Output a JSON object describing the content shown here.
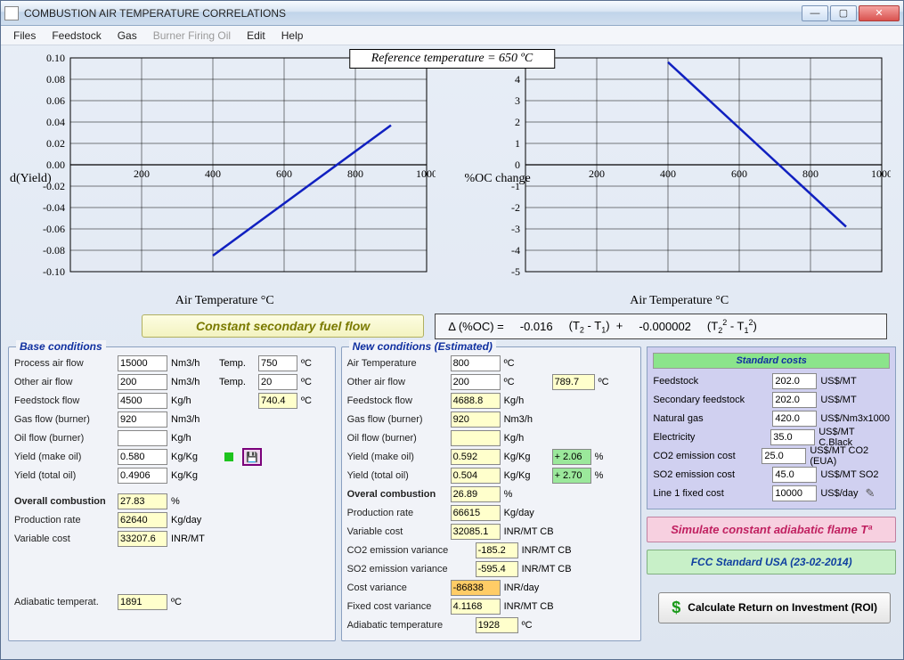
{
  "window": {
    "title": "COMBUSTION AIR TEMPERATURE CORRELATIONS"
  },
  "menu": {
    "items": [
      "Files",
      "Feedstock",
      "Gas",
      "Burner Firing Oil",
      "Edit",
      "Help"
    ],
    "disabled_index": 3
  },
  "ref_temp_label": "Reference temperature = 650 ºC",
  "chart1": {
    "ylabel": "d(Yield)",
    "xlabel": "Air Temperature °C"
  },
  "chart2": {
    "ylabel": "%OC change",
    "xlabel": "Air Temperature °C"
  },
  "constant_btn": "Constant secondary fuel flow",
  "formula": {
    "lhs": "Δ (%OC)  =",
    "a": "-0.016",
    "t1": "(T₂ - T₁)  +",
    "b": "-0.000002",
    "t2": "(T₂² - T₁²)"
  },
  "base": {
    "legend": "Base conditions",
    "rows": {
      "process_air": {
        "label": "Process air flow",
        "val": "15000",
        "unit": "Nm3/h",
        "l2": "Temp.",
        "v2": "750",
        "u2": "ºC"
      },
      "other_air": {
        "label": "Other air flow",
        "val": "200",
        "unit": "Nm3/h",
        "l2": "Temp.",
        "v2": "20",
        "u2": "ºC"
      },
      "feedstock": {
        "label": "Feedstock flow",
        "val": "4500",
        "unit": "Kg/h",
        "l2": "",
        "v2": "740.4",
        "u2": "ºC"
      },
      "gas_flow": {
        "label": "Gas flow (burner)",
        "val": "920",
        "unit": "Nm3/h"
      },
      "oil_flow": {
        "label": "Oil flow (burner)",
        "val": "",
        "unit": "Kg/h"
      },
      "yield_make": {
        "label": "Yield (make oil)",
        "val": "0.580",
        "unit": "Kg/Kg"
      },
      "yield_total": {
        "label": "Yield (total oil)",
        "val": "0.4906",
        "unit": "Kg/Kg"
      },
      "overall": {
        "label": "Overall combustion",
        "val": "27.83",
        "unit": "%"
      },
      "prod_rate": {
        "label": "Production rate",
        "val": "62640",
        "unit": "Kg/day"
      },
      "var_cost": {
        "label": "Variable cost",
        "val": "33207.6",
        "unit": "INR/MT"
      },
      "adiabatic": {
        "label": "Adiabatic temperat.",
        "val": "1891",
        "unit": "ºC"
      }
    }
  },
  "newc": {
    "legend": "New conditions (Estimated)",
    "rows": {
      "air_temp": {
        "label": "Air Temperature",
        "val": "800",
        "unit": "ºC"
      },
      "other_air": {
        "label": "Other air flow",
        "val": "200",
        "unit": "ºC",
        "v2": "789.7",
        "u2": "ºC"
      },
      "feedstock": {
        "label": "Feedstock flow",
        "val": "4688.8",
        "unit": "Kg/h"
      },
      "gas_flow": {
        "label": "Gas flow (burner)",
        "val": "920",
        "unit": "Nm3/h"
      },
      "oil_flow": {
        "label": "Oil flow (burner)",
        "val": "",
        "unit": "Kg/h"
      },
      "yield_make": {
        "label": "Yield (make oil)",
        "val": "0.592",
        "unit": "Kg/Kg",
        "delta": "+ 2.06",
        "du": "%"
      },
      "yield_total": {
        "label": "Yield (total oil)",
        "val": "0.504",
        "unit": "Kg/Kg",
        "delta": "+ 2.70",
        "du": "%"
      },
      "overall": {
        "label": "Overal combustion",
        "val": "26.89",
        "unit": "%"
      },
      "prod_rate": {
        "label": "Production rate",
        "val": "66615",
        "unit": "Kg/day"
      },
      "var_cost": {
        "label": "Variable cost",
        "val": "32085.1",
        "unit": "INR/MT CB"
      },
      "co2": {
        "label": "CO2 emission variance",
        "val": "-185.2",
        "unit": "INR/MT CB"
      },
      "so2": {
        "label": "SO2 emission variance",
        "val": "-595.4",
        "unit": "INR/MT CB"
      },
      "cost_var": {
        "label": "Cost variance",
        "val": "-86838",
        "unit": "INR/day"
      },
      "fixed_var": {
        "label": "Fixed cost variance",
        "val": "4.1168",
        "unit": "INR/MT CB"
      },
      "adiabatic": {
        "label": "Adiabatic temperature",
        "val": "1928",
        "unit": "ºC"
      }
    }
  },
  "costs": {
    "title": "Standard costs",
    "rows": [
      {
        "label": "Feedstock",
        "val": "202.0",
        "unit": "US$/MT"
      },
      {
        "label": "Secondary feedstock",
        "val": "202.0",
        "unit": "US$/MT"
      },
      {
        "label": "Natural gas",
        "val": "420.0",
        "unit": "US$/Nm3x1000"
      },
      {
        "label": "Electricity",
        "val": "35.0",
        "unit": "US$/MT C.Black"
      },
      {
        "label": "CO2 emission cost",
        "val": "25.0",
        "unit": "US$/MT CO2 (EUA)"
      },
      {
        "label": "SO2 emission cost",
        "val": "45.0",
        "unit": "US$/MT SO2"
      },
      {
        "label": "Line 1 fixed cost",
        "val": "10000",
        "unit": "US$/day"
      }
    ]
  },
  "simulate_btn": "Simulate constant adiabatic flame Tª",
  "fcc_btn": "FCC Standard USA  (23-02-2014)",
  "roi_btn": "Calculate Return on Investment (ROI)",
  "chart_data": [
    {
      "type": "line",
      "title": "",
      "xlabel": "Air Temperature °C",
      "ylabel": "d(Yield)",
      "xlim": [
        0,
        1000
      ],
      "ylim": [
        -0.1,
        0.1
      ],
      "xticks": [
        200,
        400,
        600,
        800,
        1000
      ],
      "yticks": [
        -0.1,
        -0.08,
        -0.06,
        -0.04,
        -0.02,
        0.0,
        0.02,
        0.04,
        0.06,
        0.08,
        0.1
      ],
      "series": [
        {
          "name": "d(Yield)",
          "x": [
            400,
            900
          ],
          "y": [
            -0.085,
            0.037
          ],
          "color": "#1020c0"
        }
      ]
    },
    {
      "type": "line",
      "title": "",
      "xlabel": "Air Temperature °C",
      "ylabel": "%OC change",
      "xlim": [
        0,
        1000
      ],
      "ylim": [
        -5,
        5
      ],
      "xticks": [
        200,
        400,
        600,
        800,
        1000
      ],
      "yticks": [
        -5,
        -4,
        -3,
        -2,
        -1,
        0,
        1,
        2,
        3,
        4,
        5
      ],
      "series": [
        {
          "name": "%OC change",
          "x": [
            400,
            900
          ],
          "y": [
            4.8,
            -2.9
          ],
          "color": "#1020c0"
        }
      ]
    }
  ]
}
